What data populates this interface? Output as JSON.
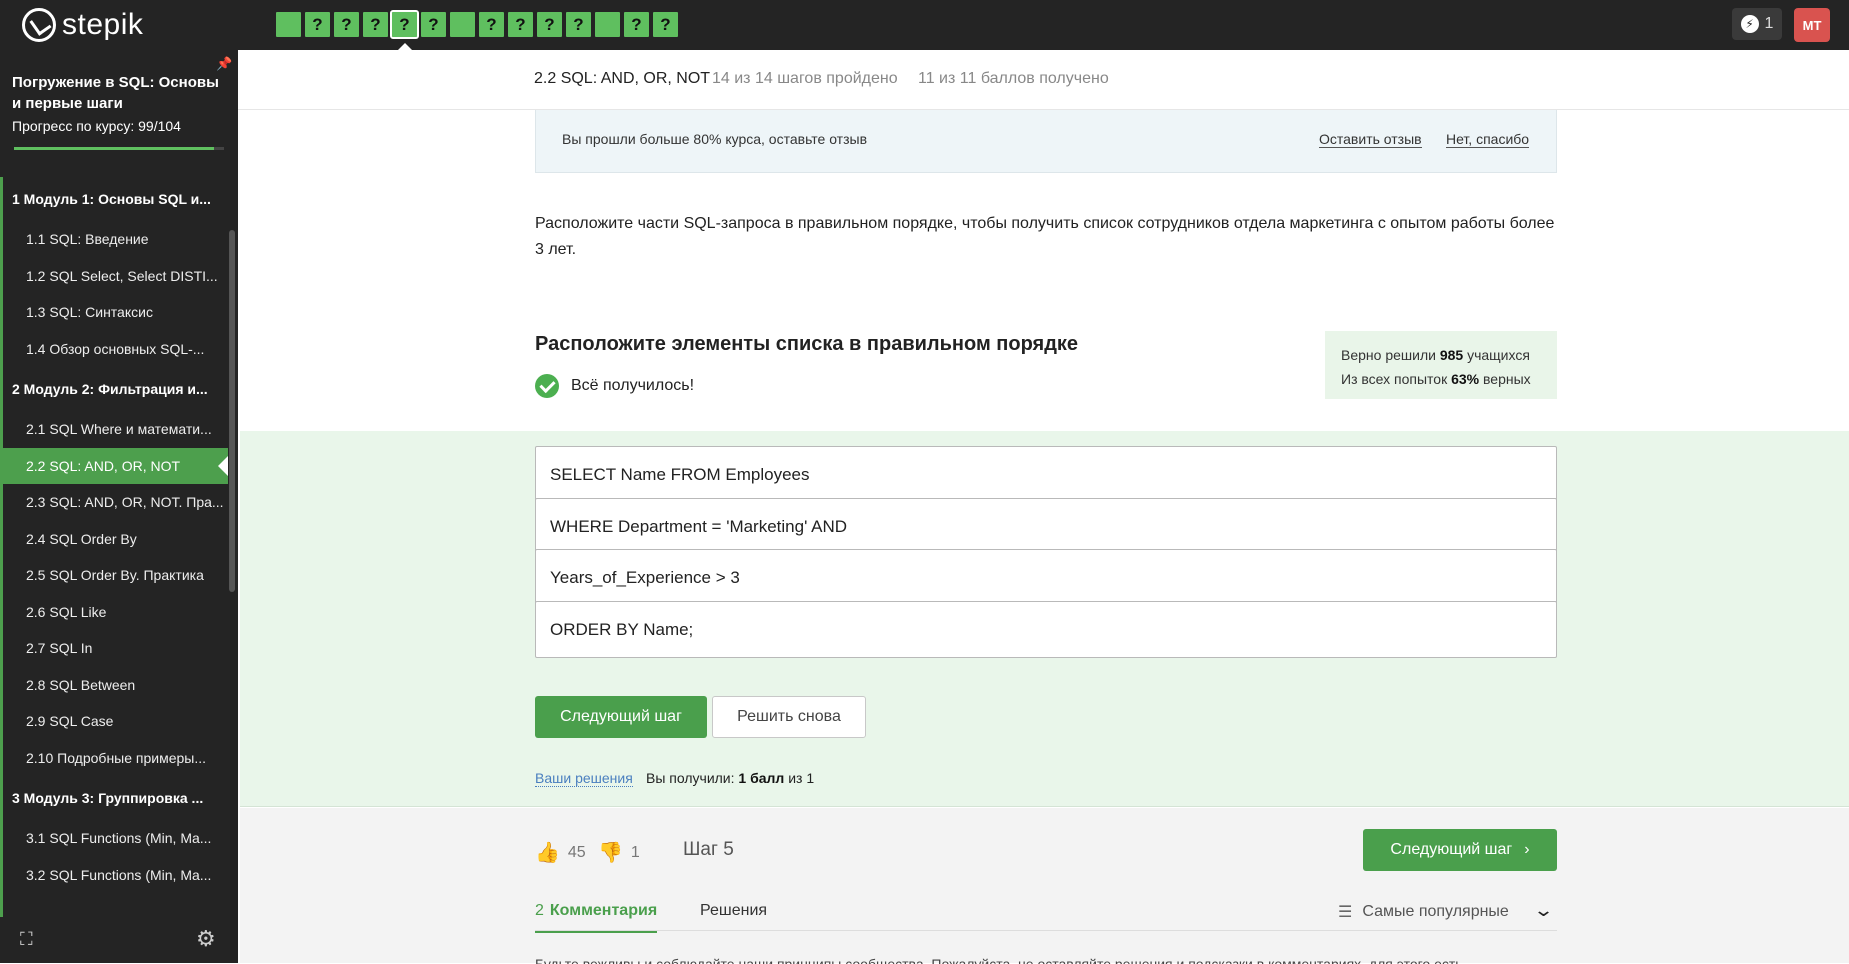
{
  "topbar": {
    "logo_text": "stepik",
    "steps": [
      "",
      "?",
      "?",
      "?",
      "?",
      "?",
      "",
      "?",
      "?",
      "?",
      "?",
      "",
      "?",
      "?"
    ],
    "active_step_index": 4,
    "streak": "1",
    "avatar": "MT",
    "colors": {
      "bg": "#242424",
      "step": "#5fbf5f",
      "avatar": "#d9534f"
    }
  },
  "sidebar": {
    "course_title": "Погружение в SQL: Основы и первые шаги",
    "progress_label": "Прогресс по курсу:  99/104",
    "progress": {
      "done": 99,
      "total": 104
    },
    "items": [
      {
        "type": "module",
        "label": "1  Модуль 1: Основы SQL и..."
      },
      {
        "type": "lesson",
        "label": "1.1  SQL: Введение"
      },
      {
        "type": "lesson",
        "label": "1.2  SQL Select, Select DISTI..."
      },
      {
        "type": "lesson",
        "label": "1.3  SQL: Синтаксис"
      },
      {
        "type": "lesson",
        "label": "1.4  Обзор основных SQL-..."
      },
      {
        "type": "module",
        "label": "2  Модуль 2: Фильтрация и..."
      },
      {
        "type": "lesson",
        "label": "2.1  SQL Where и математи..."
      },
      {
        "type": "lesson",
        "label": "2.2  SQL: AND, OR, NOT",
        "active": true
      },
      {
        "type": "lesson",
        "label": "2.3  SQL: AND, OR, NOT. Пра..."
      },
      {
        "type": "lesson",
        "label": "2.4  SQL Order By"
      },
      {
        "type": "lesson",
        "label": "2.5  SQL Order By. Практика"
      },
      {
        "type": "lesson",
        "label": "2.6  SQL Like"
      },
      {
        "type": "lesson",
        "label": "2.7  SQL In"
      },
      {
        "type": "lesson",
        "label": "2.8  SQL Between"
      },
      {
        "type": "lesson",
        "label": "2.9  SQL Case"
      },
      {
        "type": "lesson",
        "label": "2.10  Подробные примеры..."
      },
      {
        "type": "module",
        "label": "3  Модуль 3: Группировка ..."
      },
      {
        "type": "lesson",
        "label": "3.1  SQL Functions (Min, Ma..."
      },
      {
        "type": "lesson",
        "label": "3.2  SQL Functions (Min, Ma..."
      }
    ]
  },
  "lesson": {
    "name": "2.2 SQL: AND, OR, NOT",
    "steps_done": "14 из 14 шагов пройдено",
    "points": "11 из 11 баллов  получено"
  },
  "banner": {
    "text": "Вы прошли больше 80% курса, оставьте отзыв",
    "leave_review": "Оставить отзыв",
    "no_thanks": "Нет, спасибо"
  },
  "task": {
    "text": "Расположите части SQL-запроса в правильном порядке, чтобы получить список сотрудников отдела маркетинга с опытом работы более 3 лет."
  },
  "quiz": {
    "title": "Расположите элементы списка в правильном порядке",
    "success": "Всё получилось!",
    "stats_line1_prefix": "Верно решили ",
    "stats_solved": "985",
    "stats_line1_suffix": " учащихся",
    "stats_line2_prefix": "Из всех попыток ",
    "stats_percent": "63%",
    "stats_line2_suffix": " верных",
    "items": [
      "SELECT Name FROM Employees",
      "WHERE Department = 'Marketing' AND",
      "Years_of_Experience > 3",
      "ORDER BY Name;"
    ],
    "next_button": "Следующий шаг",
    "retry_button": "Решить снова",
    "solutions_link": "Ваши решения",
    "score_prefix": "Вы получили: ",
    "score_value": "1 балл",
    "score_suffix": " из 1"
  },
  "footer": {
    "likes": "45",
    "dislikes": "1",
    "step_label": "Шаг 5",
    "next_button": "Следующий шаг",
    "comments_count": "2",
    "comments_tab": "Комментария",
    "solutions_tab": "Решения",
    "sort_label": "Самые популярные",
    "rules_text": "Будьте вежливы и соблюдайте наши принципы сообщества. Пожалуйста, не оставляйте решения и подсказки в комментариях, для этого есть"
  }
}
